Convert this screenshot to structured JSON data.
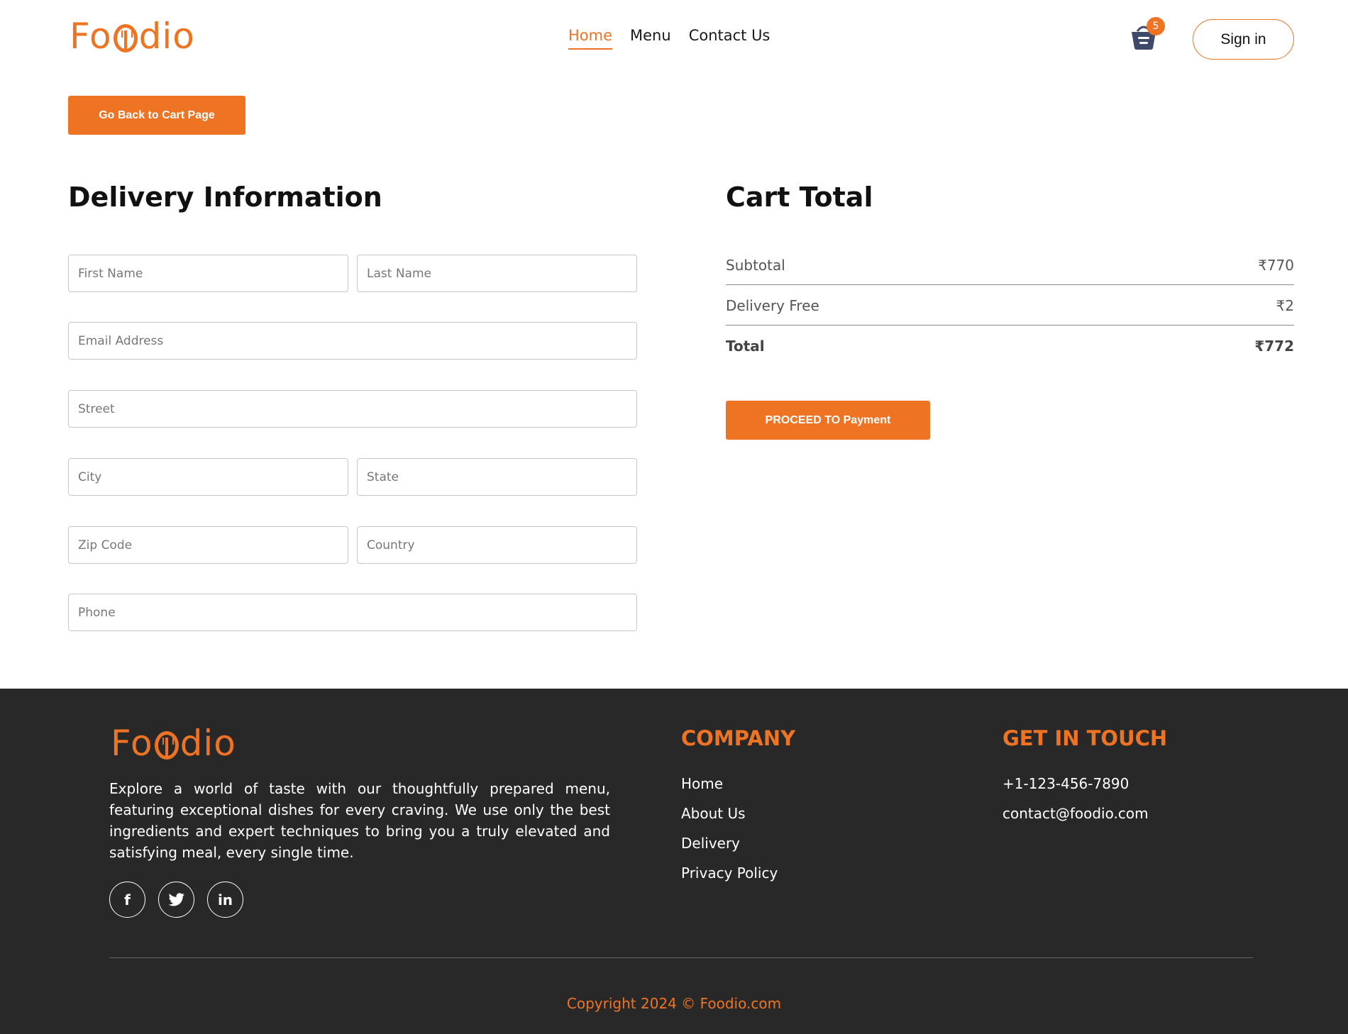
{
  "brand": {
    "name_start": "Fo",
    "name_end": "dio",
    "accent_color": "#ee7423"
  },
  "nav": {
    "items": [
      {
        "label": "Home",
        "active": true
      },
      {
        "label": "Menu",
        "active": false
      },
      {
        "label": "Contact Us",
        "active": false
      }
    ]
  },
  "header": {
    "cart_count": "5",
    "cart_icon": "basket-icon",
    "signin_label": "Sign in"
  },
  "back_button": "Go Back to Cart Page",
  "delivery": {
    "title": "Delivery Information",
    "fields": {
      "first_name": "First Name",
      "last_name": "Last Name",
      "email": "Email Address",
      "street": "Street",
      "city": "City",
      "state": "State",
      "zip": "Zip Code",
      "country": "Country",
      "phone": "Phone"
    }
  },
  "cart": {
    "title": "Cart Total",
    "subtotal_label": "Subtotal",
    "subtotal_value": "₹770",
    "delivery_label": "Delivery Free",
    "delivery_value": "₹2",
    "total_label": "Total",
    "total_value": "₹772",
    "pay_button": "PROCEED TO Payment"
  },
  "footer": {
    "description": "Explore a world of taste with our thoughtfully prepared menu, featuring exceptional dishes for every craving. We use only the best ingredients and expert techniques to bring you a truly elevated and satisfying meal, every single time.",
    "socials": [
      {
        "icon": "facebook-icon",
        "glyph": "f"
      },
      {
        "icon": "twitter-icon",
        "glyph": "t"
      },
      {
        "icon": "linkedin-icon",
        "glyph": "in"
      }
    ],
    "company_title": "COMPANY",
    "company_links": [
      "Home",
      "About Us",
      "Delivery",
      "Privacy Policy"
    ],
    "contact_title": "GET IN TOUCH",
    "contact_items": [
      "+1-123-456-7890",
      "contact@foodio.com"
    ],
    "copyright": "Copyright 2024 © Foodio.com"
  }
}
